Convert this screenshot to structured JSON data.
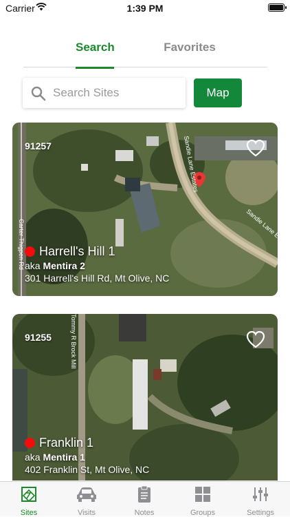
{
  "status_bar": {
    "carrier": "Carrier",
    "time": "1:39 PM"
  },
  "tabs": [
    {
      "label": "Search",
      "active": true
    },
    {
      "label": "Favorites",
      "active": false
    }
  ],
  "search": {
    "placeholder": "Search Sites",
    "value": ""
  },
  "map_button": {
    "label": "Map"
  },
  "sites": [
    {
      "id": "91257",
      "name": "Harrell's Hill 1",
      "aka_prefix": "aka",
      "aka": "Mentira 2",
      "address": "301 Harrell's Hill Rd, Mt Olive, NC",
      "favorite": false,
      "map_labels": [
        "Carter Thigpen Rd",
        "Sandie Lane Estates",
        "Sandie Lane Estates"
      ]
    },
    {
      "id": "91255",
      "name": "Franklin 1",
      "aka_prefix": "aka",
      "aka": "Mentira 1",
      "address": "402 Franklin St, Mt Olive, NC",
      "favorite": false,
      "map_labels": [
        "Tommy R Brock Mill"
      ]
    }
  ],
  "tab_bar": [
    {
      "label": "Sites",
      "active": true
    },
    {
      "label": "Visits",
      "active": false
    },
    {
      "label": "Notes",
      "active": false
    },
    {
      "label": "Groups",
      "active": false
    },
    {
      "label": "Settings",
      "active": false
    }
  ],
  "colors": {
    "accent": "#1a8a2c",
    "map_button": "#14883a",
    "status_dot": "#f20c0c",
    "inactive": "#8e8e93"
  }
}
